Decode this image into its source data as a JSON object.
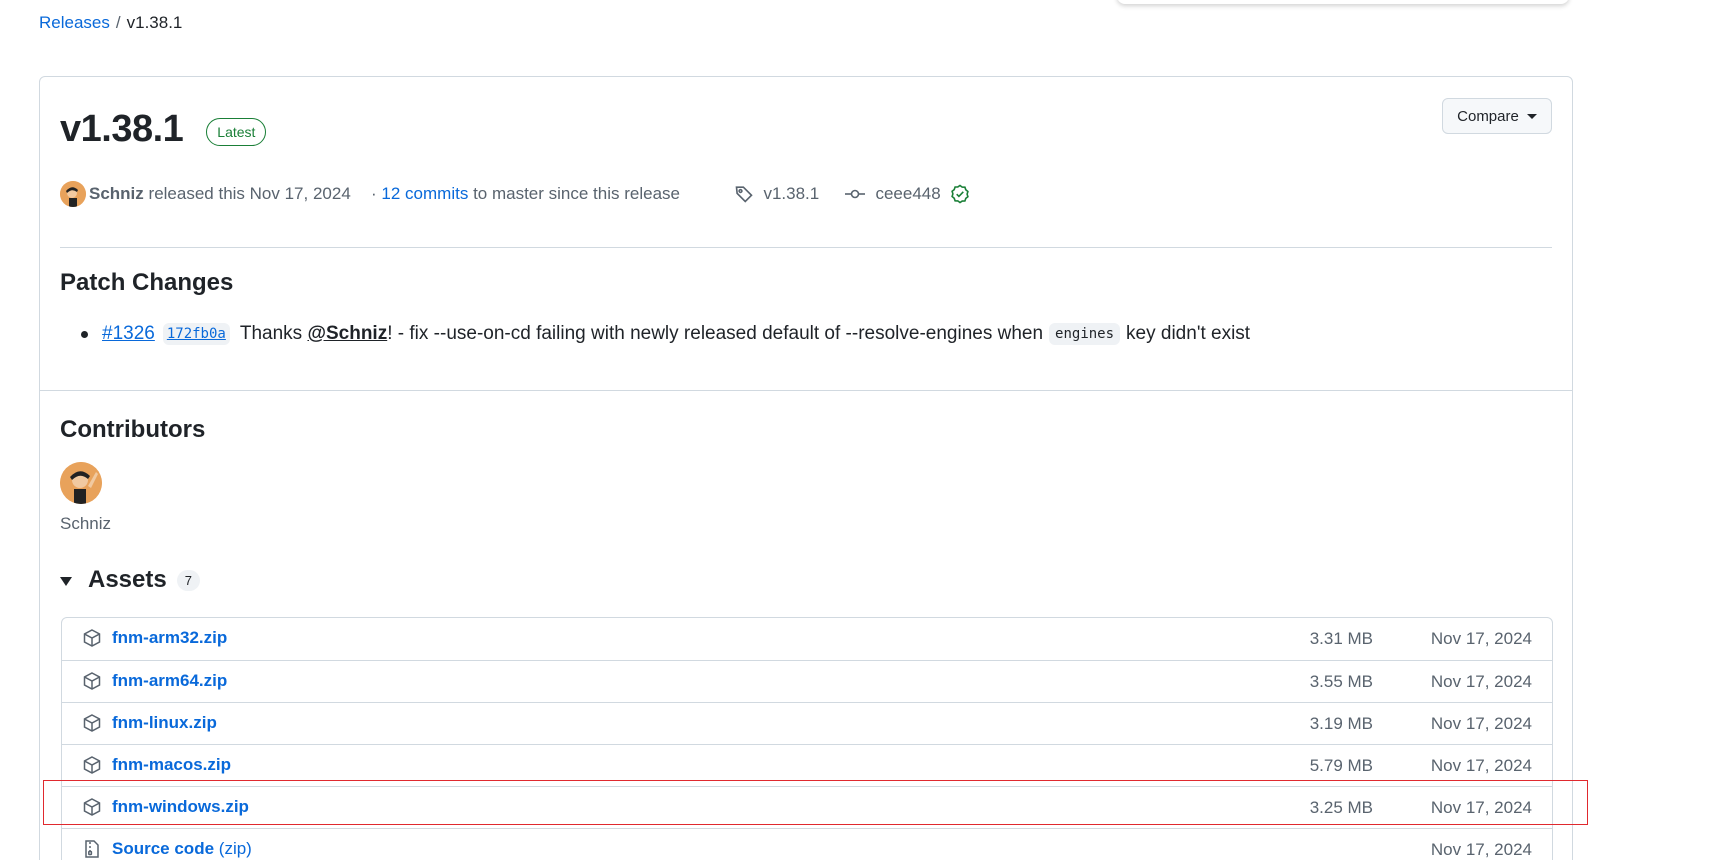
{
  "breadcrumb": {
    "releases": "Releases",
    "separator": "/",
    "current": "v1.38.1"
  },
  "release": {
    "version": "v1.38.1",
    "latest_badge": "Latest",
    "compare_label": "Compare",
    "author": "Schniz",
    "released_text": "released this Nov 17, 2024",
    "commits_prefix": "·",
    "commits_link": "12 commits",
    "commits_suffix": "to master since this release",
    "tag": "v1.38.1",
    "commit": "ceee448"
  },
  "patch": {
    "heading": "Patch Changes",
    "pr": "#1326",
    "commit": "172fb0a",
    "thanks": "Thanks",
    "mention": "@Schniz",
    "text1": "! - fix --use-on-cd failing with newly released default of --resolve-engines when",
    "code": "engines",
    "text2": "key didn't exist"
  },
  "contributors": {
    "heading": "Contributors",
    "names": [
      "Schniz"
    ]
  },
  "assets": {
    "heading": "Assets",
    "count": "7",
    "items": [
      {
        "name": "fnm-arm32.zip",
        "size": "3.31 MB",
        "date": "Nov 17, 2024"
      },
      {
        "name": "fnm-arm64.zip",
        "size": "3.55 MB",
        "date": "Nov 17, 2024"
      },
      {
        "name": "fnm-linux.zip",
        "size": "3.19 MB",
        "date": "Nov 17, 2024"
      },
      {
        "name": "fnm-macos.zip",
        "size": "5.79 MB",
        "date": "Nov 17, 2024"
      },
      {
        "name": "fnm-windows.zip",
        "size": "3.25 MB",
        "date": "Nov 17, 2024"
      },
      {
        "name": "Source code",
        "sub": "(zip)",
        "size": "",
        "date": "Nov 17, 2024"
      }
    ]
  },
  "colors": {
    "link": "#0969da",
    "latest": "#1a7f37",
    "highlight": "#e0292e",
    "muted": "#59636e"
  }
}
